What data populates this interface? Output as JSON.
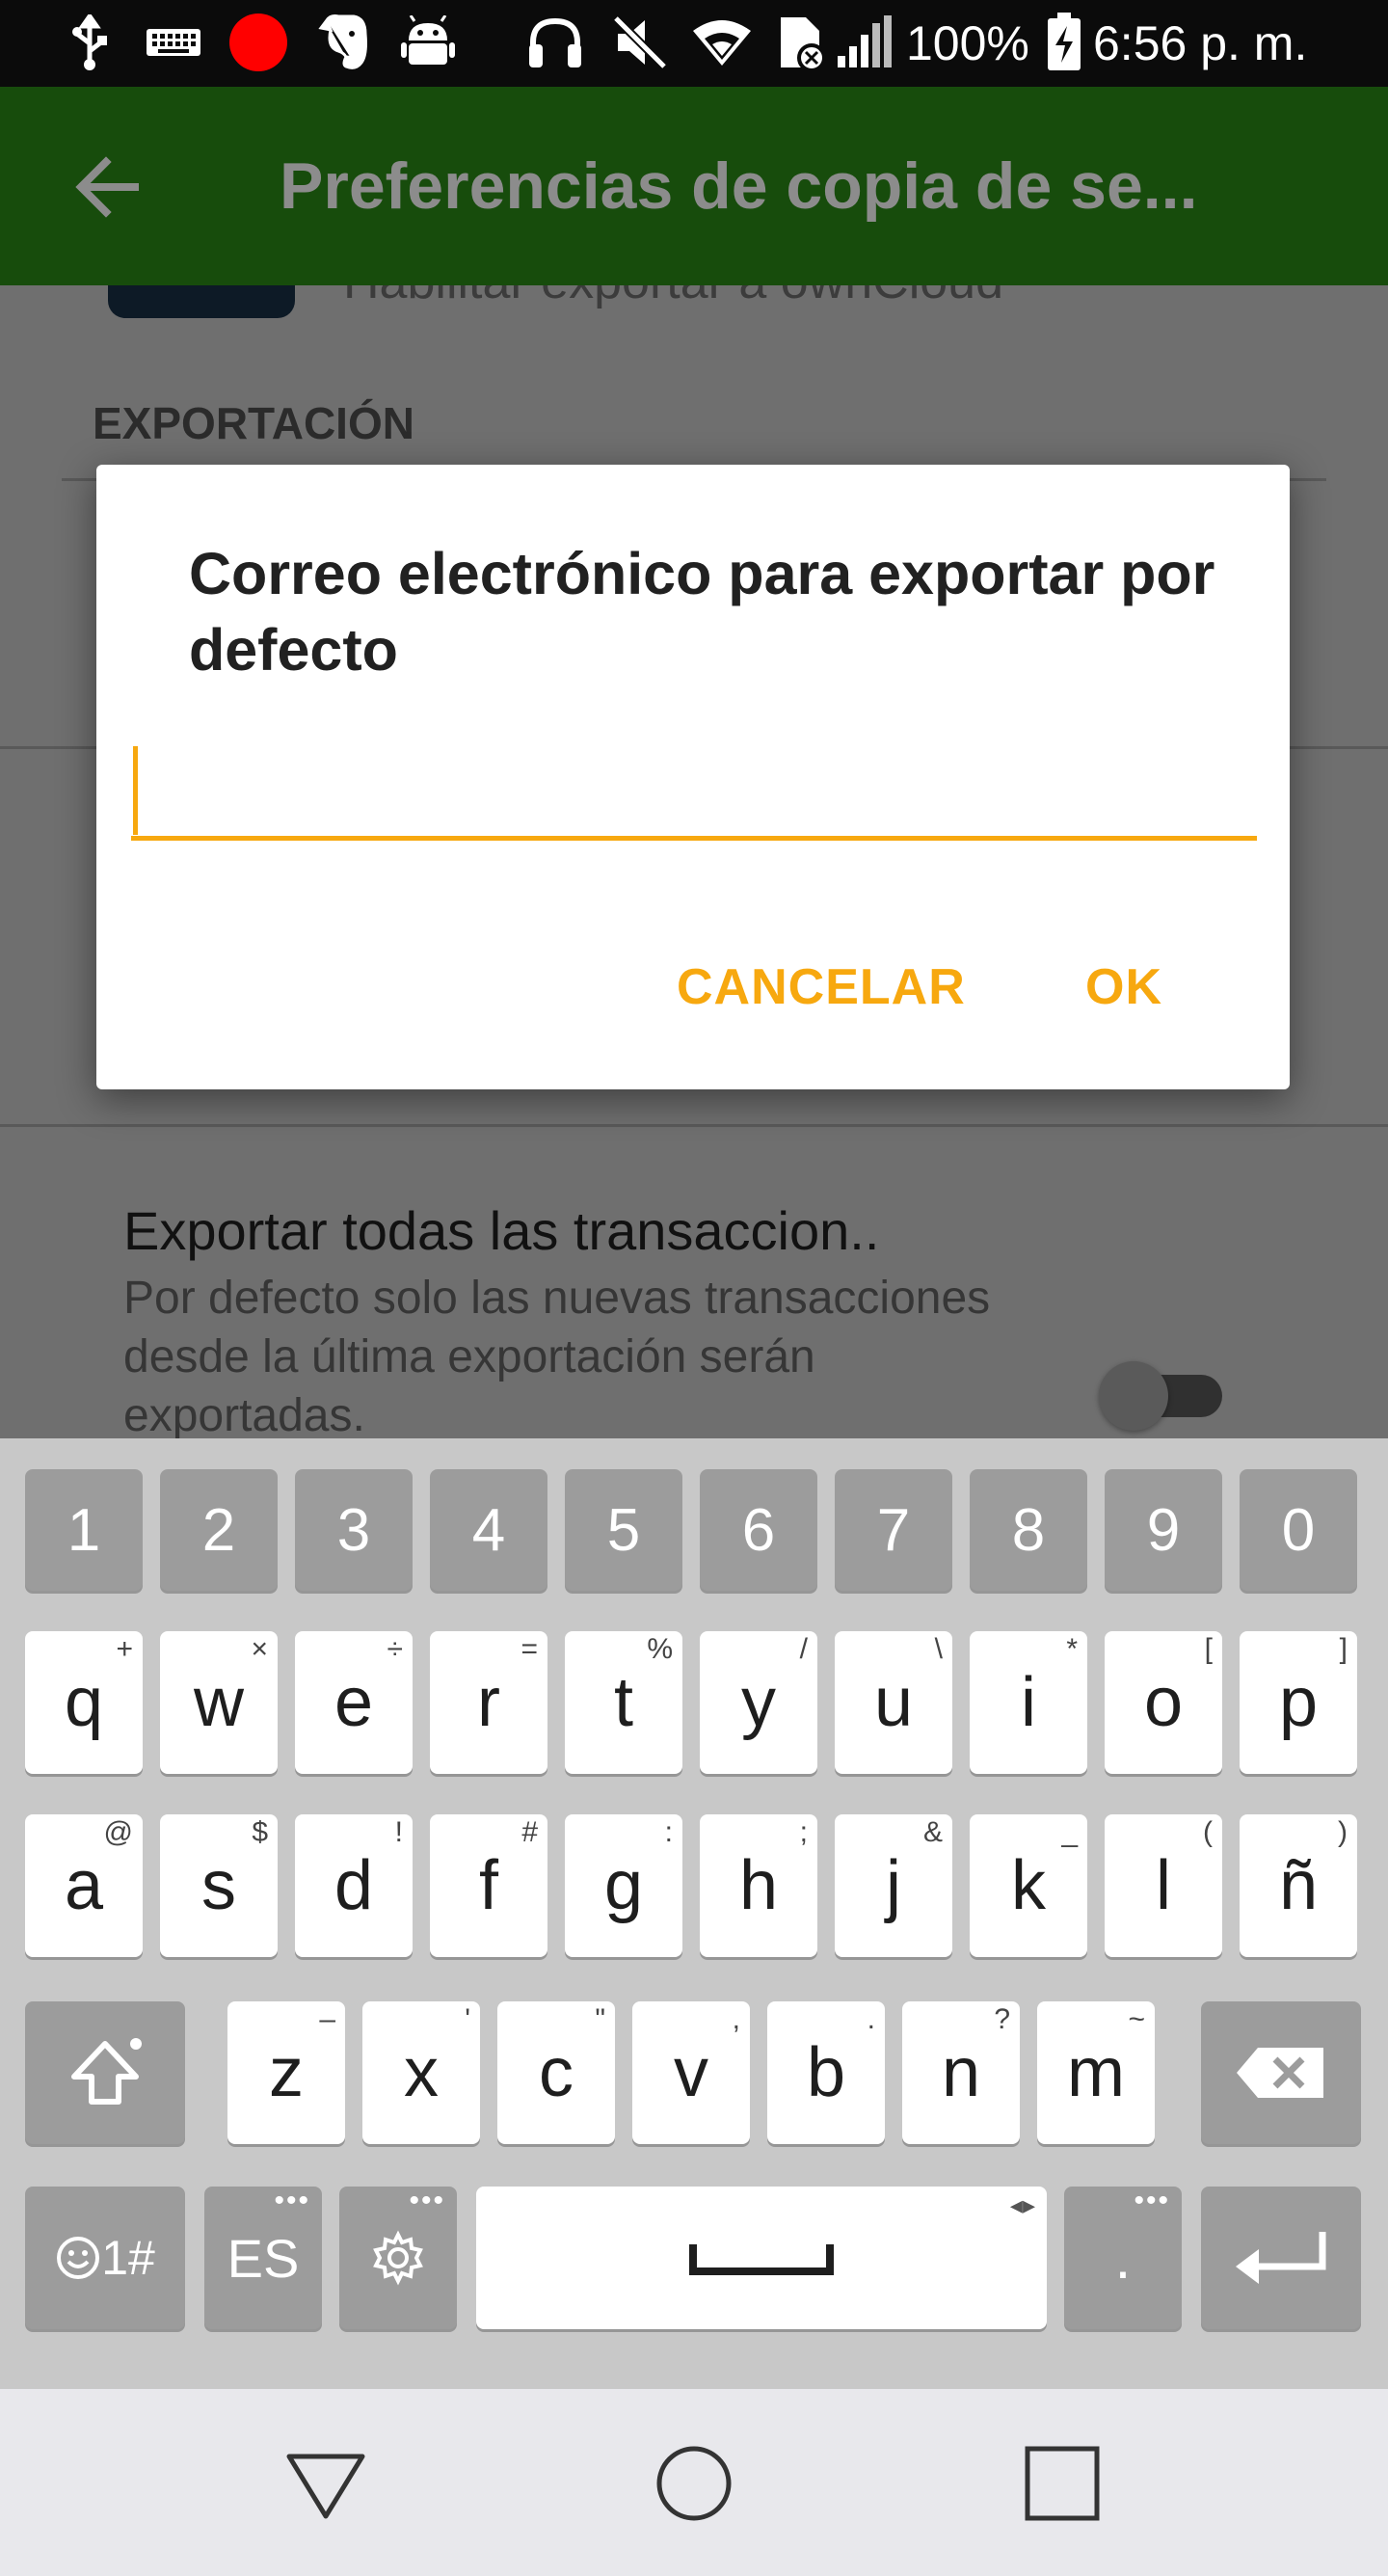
{
  "status_bar": {
    "icons": [
      "usb-icon",
      "keyboard-icon",
      "record-icon",
      "evernote-icon",
      "android-icon",
      "headphones-icon",
      "mute-icon",
      "wifi-icon",
      "sim-blocked-icon",
      "signal-icon",
      "battery-charging-icon"
    ],
    "battery": "100%",
    "time": "6:56 p. m.",
    "record_color": "#ff0000"
  },
  "app_bar": {
    "title": "Preferencias de copia de se...",
    "color": "#174c0c"
  },
  "background": {
    "partial_text": "Habilitar exportar a ownCloud",
    "section_header": "EXPORTACIÓN",
    "pref_title": "Exportar todas las transaccion..",
    "pref_summary": "Por defecto solo las nuevas transacciones desde la última exportación serán exportadas."
  },
  "dialog": {
    "title": "Correo electrónico para exportar por defecto",
    "input_value": "",
    "cancel_label": "CANCELAR",
    "ok_label": "OK",
    "accent": "#f7a80f"
  },
  "keyboard": {
    "numbers": [
      "1",
      "2",
      "3",
      "4",
      "5",
      "6",
      "7",
      "8",
      "9",
      "0"
    ],
    "row1": [
      {
        "k": "q",
        "h": "+"
      },
      {
        "k": "w",
        "h": "×"
      },
      {
        "k": "e",
        "h": "÷"
      },
      {
        "k": "r",
        "h": "="
      },
      {
        "k": "t",
        "h": "%"
      },
      {
        "k": "y",
        "h": "/"
      },
      {
        "k": "u",
        "h": "\\"
      },
      {
        "k": "i",
        "h": "*"
      },
      {
        "k": "o",
        "h": "["
      },
      {
        "k": "p",
        "h": "]"
      }
    ],
    "row2": [
      {
        "k": "a",
        "h": "@"
      },
      {
        "k": "s",
        "h": "$"
      },
      {
        "k": "d",
        "h": "!"
      },
      {
        "k": "f",
        "h": "#"
      },
      {
        "k": "g",
        "h": ":"
      },
      {
        "k": "h",
        "h": ";"
      },
      {
        "k": "j",
        "h": "&"
      },
      {
        "k": "k",
        "h": "_"
      },
      {
        "k": "l",
        "h": "("
      },
      {
        "k": "ñ",
        "h": ")"
      }
    ],
    "row3": [
      {
        "k": "z",
        "h": "–"
      },
      {
        "k": "x",
        "h": "'"
      },
      {
        "k": "c",
        "h": "\""
      },
      {
        "k": "v",
        "h": ","
      },
      {
        "k": "b",
        "h": "."
      },
      {
        "k": "n",
        "h": "?"
      },
      {
        "k": "m",
        "h": "~"
      }
    ],
    "symbols_label": "1#",
    "language_label": "ES",
    "period_label": "."
  }
}
